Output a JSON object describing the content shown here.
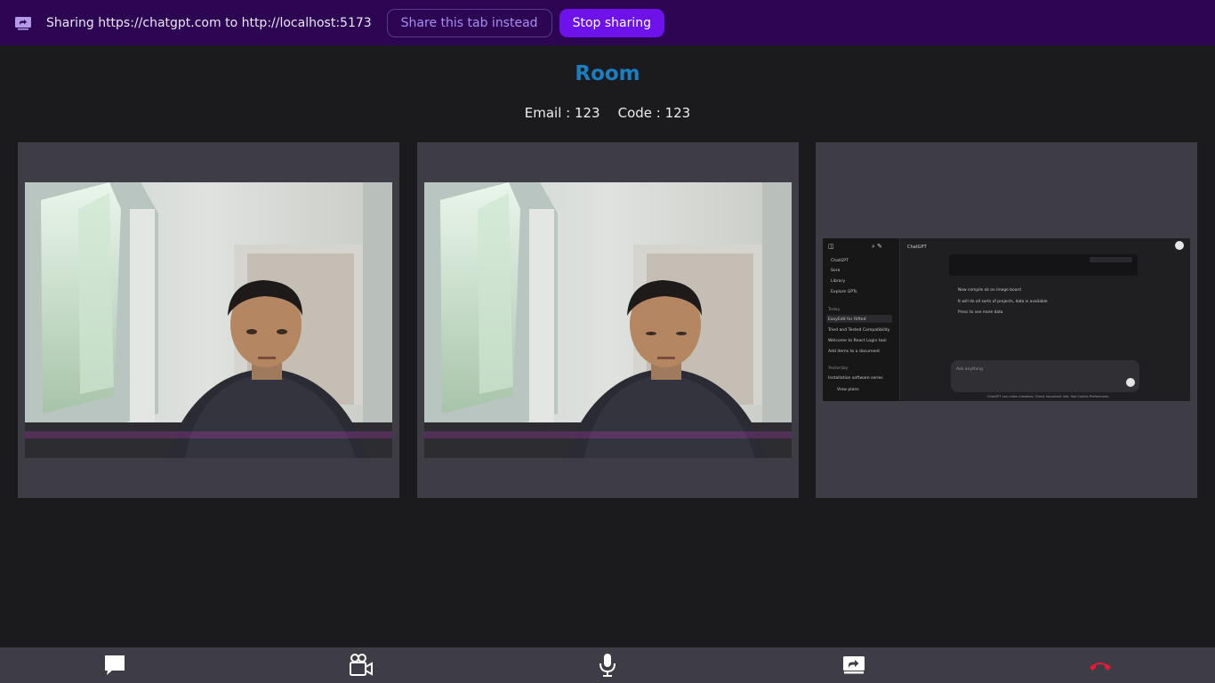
{
  "share_bar": {
    "message": "Sharing https://chatgpt.com to http://localhost:5173",
    "share_tab_label": "Share this tab instead",
    "stop_label": "Stop sharing"
  },
  "room": {
    "title": "Room",
    "email_text": "Email : 123",
    "code_text": "Code : 123"
  },
  "streams": [
    {
      "kind": "camera"
    },
    {
      "kind": "camera"
    },
    {
      "kind": "screen",
      "sidebar": [
        "ChatGPT",
        "Sora",
        "Library",
        "Explore GPTs"
      ],
      "sidebar_section": "Today",
      "sidebar_chats": [
        "EasyEdit for Rifted",
        "Tried and Tested Compatibility",
        "Welcome to React Login tool",
        "Add items to a document"
      ],
      "sidebar_section2": "Yesterday",
      "sidebar_chats2": [
        "Installation software series"
      ],
      "user_label": "View plans",
      "model_label": "ChatGPT",
      "bullets": [
        "Now compile ok on image board",
        "It will do all sorts of projects, data is available",
        "Press to see more data"
      ],
      "composer_placeholder": "Ask anything",
      "footer_note": "ChatGPT can make mistakes. Check important info. See Cookie Preferences."
    }
  ],
  "toolbar": {
    "icons": [
      "chat-icon",
      "video-camera-icon",
      "microphone-icon",
      "screen-share-icon",
      "end-call-icon"
    ],
    "end_call_color": "#e5193c"
  },
  "colors": {
    "share_bar": "#2c0652",
    "stop_button": "#6d12eb",
    "room_title": "#1b7ec2",
    "background": "#1b1b1e",
    "tile": "#3e3d45"
  }
}
